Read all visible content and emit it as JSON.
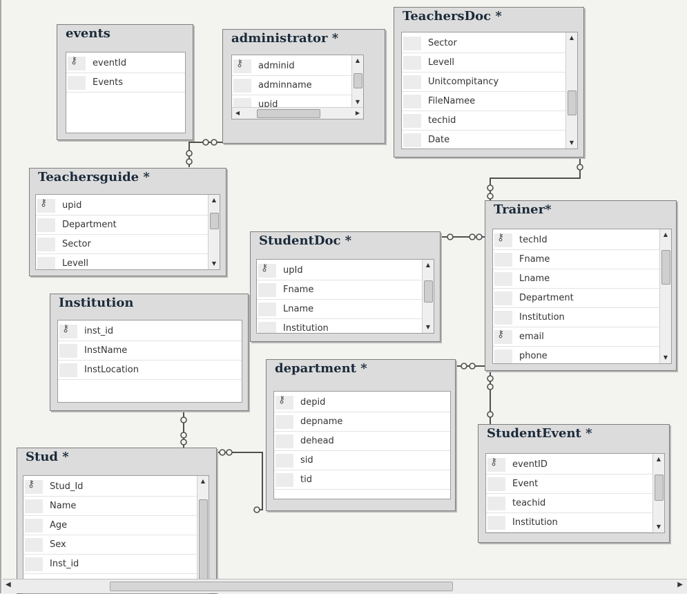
{
  "tables": [
    {
      "key": "events",
      "title": "events",
      "fields": [
        {
          "name": "eventId",
          "pk": true
        },
        {
          "name": "Events",
          "pk": false
        }
      ]
    },
    {
      "key": "administrator",
      "title": "administrator *",
      "fields": [
        {
          "name": "adminid",
          "pk": true
        },
        {
          "name": "adminname",
          "pk": false
        },
        {
          "name": "upid",
          "pk": false
        }
      ]
    },
    {
      "key": "teachersdoc",
      "title": "TeachersDoc *",
      "fields": [
        {
          "name": "Sector",
          "pk": false
        },
        {
          "name": "Levell",
          "pk": false
        },
        {
          "name": "Unitcompitancy",
          "pk": false
        },
        {
          "name": "FileNamee",
          "pk": false
        },
        {
          "name": "techid",
          "pk": false
        },
        {
          "name": "Date",
          "pk": false
        }
      ]
    },
    {
      "key": "teachersguide",
      "title": "Teachersguide *",
      "fields": [
        {
          "name": "upid",
          "pk": true
        },
        {
          "name": "Department",
          "pk": false
        },
        {
          "name": "Sector",
          "pk": false
        },
        {
          "name": "Levell",
          "pk": false
        }
      ]
    },
    {
      "key": "trainer",
      "title": "Trainer*",
      "fields": [
        {
          "name": "techId",
          "pk": true
        },
        {
          "name": "Fname",
          "pk": false
        },
        {
          "name": "Lname",
          "pk": false
        },
        {
          "name": "Department",
          "pk": false
        },
        {
          "name": "Institution",
          "pk": false
        },
        {
          "name": "email",
          "pk": true
        },
        {
          "name": "phone",
          "pk": false
        }
      ]
    },
    {
      "key": "studentdoc",
      "title": "StudentDoc *",
      "fields": [
        {
          "name": "upId",
          "pk": true
        },
        {
          "name": "Fname",
          "pk": false
        },
        {
          "name": "Lname",
          "pk": false
        },
        {
          "name": "Institution",
          "pk": false
        }
      ]
    },
    {
      "key": "institution",
      "title": "Institution",
      "fields": [
        {
          "name": "inst_id",
          "pk": true
        },
        {
          "name": "InstName",
          "pk": false
        },
        {
          "name": "InstLocation",
          "pk": false
        }
      ]
    },
    {
      "key": "department",
      "title": "department *",
      "fields": [
        {
          "name": "depid",
          "pk": true
        },
        {
          "name": "depname",
          "pk": false
        },
        {
          "name": "dehead",
          "pk": false
        },
        {
          "name": "sid",
          "pk": false
        },
        {
          "name": "tid",
          "pk": false
        }
      ]
    },
    {
      "key": "studentevent",
      "title": "StudentEvent *",
      "fields": [
        {
          "name": "eventID",
          "pk": true
        },
        {
          "name": "Event",
          "pk": false
        },
        {
          "name": "teachid",
          "pk": false
        },
        {
          "name": "Institution",
          "pk": false
        }
      ]
    },
    {
      "key": "stud",
      "title": "Stud *",
      "fields": [
        {
          "name": "Stud_Id",
          "pk": true
        },
        {
          "name": "Name",
          "pk": false
        },
        {
          "name": "Age",
          "pk": false
        },
        {
          "name": "Sex",
          "pk": false
        },
        {
          "name": "Inst_id",
          "pk": false
        }
      ]
    }
  ],
  "icons": {
    "primary_key": "key-icon",
    "scroll_up": "scroll-up-icon",
    "scroll_down": "scroll-down-icon"
  },
  "colors": {
    "panel": "#dcdcdc",
    "grid": "#ffffff",
    "connector": "#555555"
  }
}
